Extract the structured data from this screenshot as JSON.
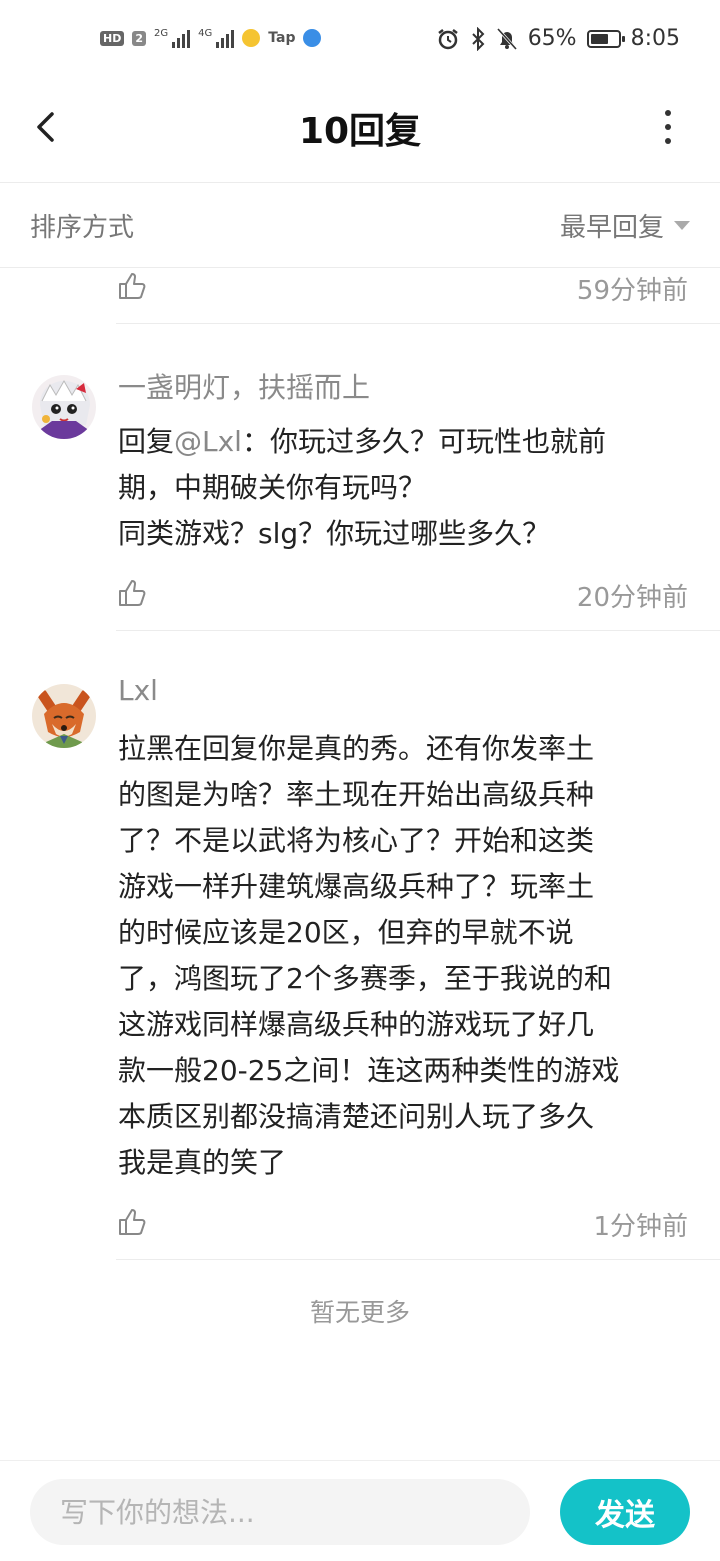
{
  "status_bar": {
    "hd_label": "HD",
    "sim_label": "2",
    "net1": "2G",
    "net2": "4G",
    "tap_label": "Tap",
    "battery_percent": "65%",
    "battery_level": 0.65,
    "time": "8:05"
  },
  "header": {
    "title": "10回复"
  },
  "sort": {
    "label": "排序方式",
    "value": "最早回复"
  },
  "replies": [
    {
      "time": "59分钟前"
    },
    {
      "username": "一盏明灯，扶摇而上",
      "reply_prefix": "回复",
      "mention": "@Lxl",
      "lines": [
        "：你玩过多久？可玩性也就前",
        "期，中期破关你有玩吗？",
        "同类游戏？slg？你玩过哪些多久？"
      ],
      "time": "20分钟前"
    },
    {
      "username": "Lxl",
      "lines": [
        "拉黑在回复你是真的秀。还有你发率土",
        "的图是为啥？率土现在开始出高级兵种",
        "了？不是以武将为核心了？开始和这类",
        "游戏一样升建筑爆高级兵种了？玩率土",
        "的时候应该是20区，但弃的早就不说",
        "了，鸿图玩了2个多赛季，至于我说的和",
        "这游戏同样爆高级兵种的游戏玩了好几",
        "款一般20-25之间！连这两种类性的游戏",
        "本质区别都没搞清楚还问别人玩了多久",
        "我是真的笑了"
      ],
      "time": "1分钟前"
    }
  ],
  "footer_note": "暂无更多",
  "composer": {
    "placeholder": "写下你的想法...",
    "value": "",
    "send_label": "发送"
  },
  "colors": {
    "accent": "#14c2c8",
    "muted_text": "#999999",
    "divider": "#ececec"
  }
}
